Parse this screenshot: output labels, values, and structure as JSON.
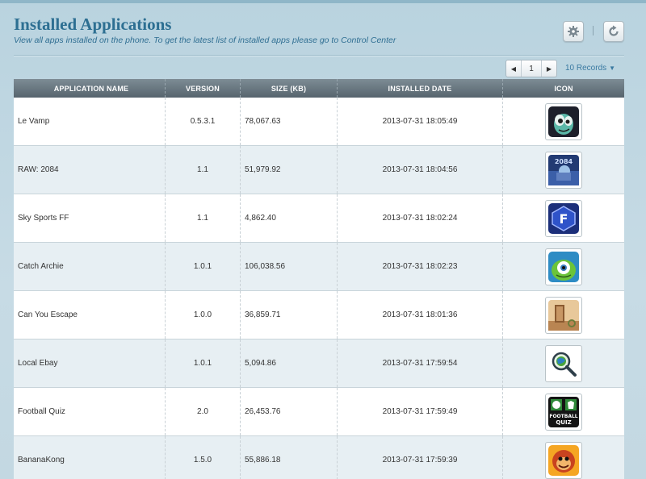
{
  "header": {
    "title": "Installed Applications",
    "subtitle": "View all apps installed on the phone. To get the latest list of installed apps please go to Control Center"
  },
  "toolbar": {
    "settings_icon": "gear-icon",
    "refresh_icon": "refresh-icon"
  },
  "pagination": {
    "current_page": "1",
    "records_label": "10 Records"
  },
  "table": {
    "columns": [
      "APPLICATION NAME",
      "VERSION",
      "SIZE (KB)",
      "INSTALLED DATE",
      "ICON"
    ],
    "rows": [
      {
        "name": "Le Vamp",
        "version": "0.5.3.1",
        "size": "78,067.63",
        "date": "2013-07-31 18:05:49",
        "icon": "le-vamp-app-icon"
      },
      {
        "name": "RAW: 2084",
        "version": "1.1",
        "size": "51,979.92",
        "date": "2013-07-31 18:04:56",
        "icon": "raw-2084-app-icon"
      },
      {
        "name": "Sky Sports FF",
        "version": "1.1",
        "size": "4,862.40",
        "date": "2013-07-31 18:02:24",
        "icon": "sky-sports-ff-app-icon"
      },
      {
        "name": "Catch Archie",
        "version": "1.0.1",
        "size": "106,038.56",
        "date": "2013-07-31 18:02:23",
        "icon": "catch-archie-app-icon"
      },
      {
        "name": "Can You Escape",
        "version": "1.0.0",
        "size": "36,859.71",
        "date": "2013-07-31 18:01:36",
        "icon": "can-you-escape-app-icon"
      },
      {
        "name": "Local Ebay",
        "version": "1.0.1",
        "size": "5,094.86",
        "date": "2013-07-31 17:59:54",
        "icon": "local-ebay-app-icon"
      },
      {
        "name": "Football Quiz",
        "version": "2.0",
        "size": "26,453.76",
        "date": "2013-07-31 17:59:49",
        "icon": "football-quiz-app-icon"
      },
      {
        "name": "BananaKong",
        "version": "1.5.0",
        "size": "55,886.18",
        "date": "2013-07-31 17:59:39",
        "icon": "banana-kong-app-icon"
      }
    ]
  },
  "icon_art": {
    "football_quiz_line1": "FOOTBALL",
    "football_quiz_line2": "QUIZ",
    "raw_2084_text": "2084",
    "sky_sports_letter": "F"
  },
  "colors": {
    "title": "#2d6f92",
    "header_bar": "#56646d",
    "row_alt": "#e7eff3",
    "link": "#3a7aa1"
  }
}
